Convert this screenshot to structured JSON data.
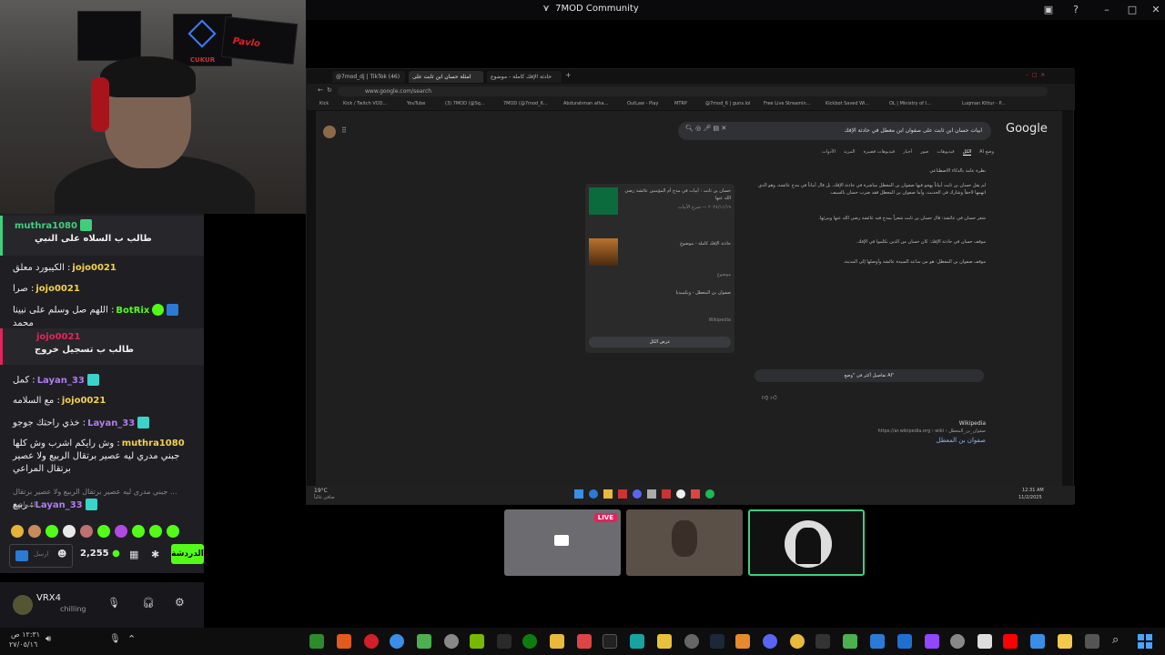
{
  "window": {
    "title": "7MOD Community"
  },
  "webcam": {
    "posters": [
      "CUKUR",
      "Pavlo"
    ]
  },
  "chat": {
    "messages": [
      {
        "user": "muthra1080",
        "text": "طالب ب السلاه على النبي",
        "color": "#3fcf7c",
        "pinned": true
      },
      {
        "user": "jojo0021",
        "text": "الكيبورد معلق",
        "color": "#f5d24a"
      },
      {
        "user": "jojo0021",
        "text": "صرا",
        "color": "#f5d24a"
      },
      {
        "user": "BotRix",
        "text": "اللهم صل وسلم على نبينا محمد",
        "color": "#53fc18"
      },
      {
        "user": "jojo0021",
        "text": "طالب ب تسجيل خروج",
        "color": "#e3245a",
        "pinned": true
      },
      {
        "user": "Layan_33",
        "text": "كمل",
        "color": "#b07cf0"
      },
      {
        "user": "jojo0021",
        "text": "مع السلامه",
        "color": "#f5d24a"
      },
      {
        "user": "Layan_33",
        "text": "خذي راحتك جوجو",
        "color": "#b07cf0"
      },
      {
        "user": "muthra1080",
        "text": "وش رايكم اشرب وش كلها جبني مدري ليه عصير برتقال الربيع ولا عصير برتقال المراعي",
        "color": "#f5d24a"
      },
      {
        "user": "",
        "text": "... جبني مدري ليه عصير برتقال الربيع ولا عصير برتقال المراعي",
        "color": "#888"
      },
      {
        "user": "Layan_33",
        "text": "ربيع",
        "color": "#b07cf0"
      }
    ],
    "points": "2,255",
    "chat_button": "الدردشة",
    "input_placeholder": "ارسل"
  },
  "discord": {
    "user": "VRX4",
    "status": "chilling"
  },
  "browser": {
    "tabs": [
      "@7mod_dj | TikTok (46)",
      "امثلة حسان ابن ثابت على د...",
      "حادثة الإفك كاملة - موضوع"
    ],
    "url": "www.google.com/search",
    "bookmarks": [
      "Kick",
      "Kick / Twitch VOD...",
      "YouTube",
      "(3) 7MOD (@Sq...",
      "7MOD (@7mod_6...",
      "Abdurahman alha...",
      "OutLaw - Play",
      "MTRP",
      "@7mod_6 | guns.lol",
      "Free Live Streamin...",
      "Kickbot Saved Wi...",
      "OL | Ministry of I...",
      "Luqman Kittur - P..."
    ],
    "query": "ابيات حسان ابن ثابت على صفوان ابن معطل في حادثة الإفك",
    "google": "Google",
    "filters": [
      "وضع AI",
      "الكل",
      "فيديوهات",
      "صور",
      "أخبار",
      "فيديوهات قصيرة",
      "المزيد",
      "الأدوات"
    ],
    "ai_heading": "نظرة عامة بالذكاء الاصطناعي",
    "ai_text": "لم يقل حسان بن ثابت أبياتاً يهجو فيها صفوان بن المعطل مباشرة في حادثة الإفك، بل قال أبياتاً في مدح عائشة، وهو الذي اتهمها لاحقاً وشارك في الحديث، وأما صفوان بن المعطل فقد ضرب حسان بالسيف.",
    "ai_points": [
      "شعر حسان في عائشة: قال حسان بن ثابت شعراً يمدح فيه عائشة رضي الله عنها ويبرئها.",
      "موقف حسان في حادثة الإفك: كان حسان من الذين تكلموا في الإفك.",
      "موقف صفوان بن المعطل: هو من ساعد السيدة عائشة وأوصلها إلى المدينة."
    ],
    "ai_more": "تفاصيل أكثر في \"وضع AI\"",
    "cards": [
      {
        "title": "حسان بن ثابت : أبيات في مدح أم المؤمنين عائشة رضي الله عنها",
        "meta": "٢٠٢٤/١١/١٩ — شرح الأبيات"
      },
      {
        "title": "حادثة الإفك كاملة - موضوع",
        "meta": "موضوع"
      },
      {
        "title": "صفوان بن المعطل - ويكيبيديا",
        "meta": "Wikipedia"
      }
    ],
    "show_all": "عرض الكل",
    "result_source": "Wikipedia",
    "result_url": "https://ar.wikipedia.org › wiki › صفوان_بن_المعطل",
    "result_title": "صفوان بن المعطل",
    "weather": "19°C",
    "weather_sub": "صافي غالباً",
    "clock": "12:31 AM",
    "date": "11/2/2025"
  },
  "stream": {
    "live_label": "LIVE"
  },
  "system": {
    "time": "١٢:٣١ ص",
    "date": "٢٧/٠٥/١٦"
  }
}
